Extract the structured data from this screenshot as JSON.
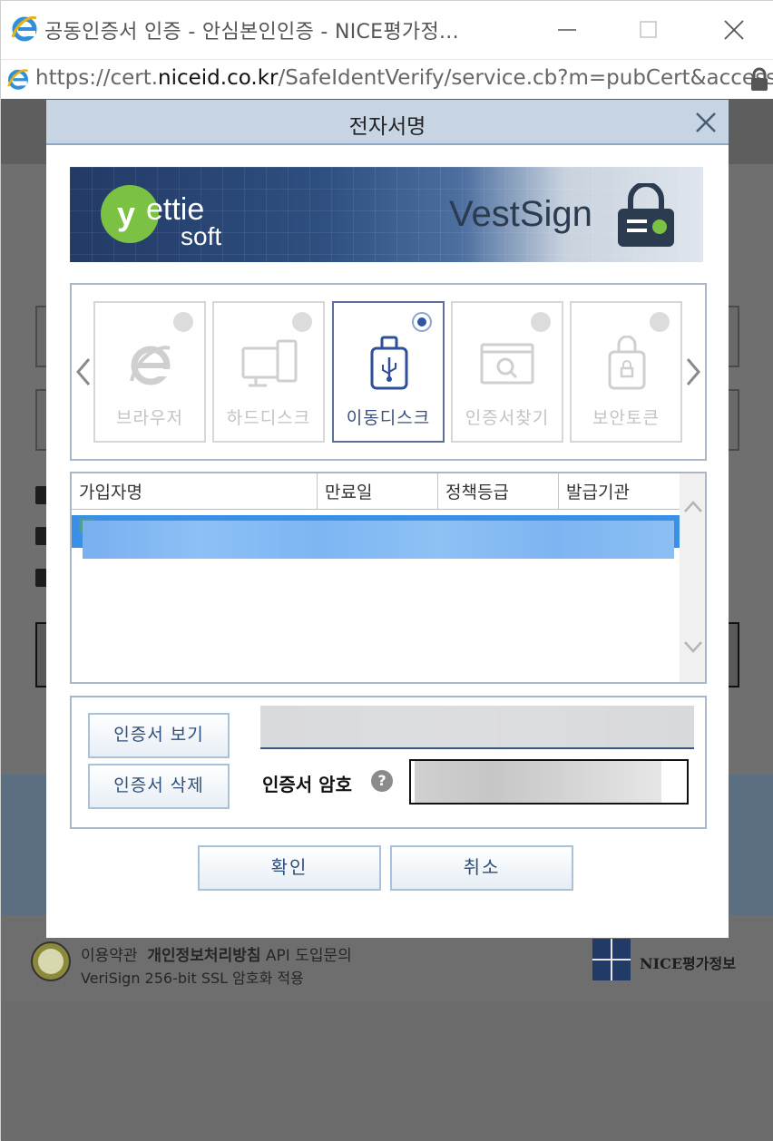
{
  "window": {
    "title": "공동인증서 인증 - 안심본인인증 - NICE평가정...",
    "url_prefix": "https://cert.",
    "url_host": "niceid.co.kr",
    "url_path": "/SafeIdentVerify/service.cb?m=pubCert&access_ni"
  },
  "dialog": {
    "title": "전자서명",
    "banner": {
      "left_logo_text": "yettie soft",
      "right_logo_text": "VestSign"
    },
    "storage_options": [
      {
        "label": "브라우저",
        "icon": "browser-icon",
        "selected": false
      },
      {
        "label": "하드디스크",
        "icon": "harddisk-icon",
        "selected": false
      },
      {
        "label": "이동디스크",
        "icon": "usb-drive-icon",
        "selected": true
      },
      {
        "label": "인증서찾기",
        "icon": "find-cert-icon",
        "selected": false
      },
      {
        "label": "보안토큰",
        "icon": "security-token-icon",
        "selected": false
      }
    ],
    "table": {
      "columns": [
        "가입자명",
        "만료일",
        "정책등급",
        "발급기관"
      ]
    },
    "buttons": {
      "view_cert": "인증서 보기",
      "delete_cert": "인증서 삭제",
      "ok": "확인",
      "cancel": "취소"
    },
    "password_label": "인증서 암호",
    "help_symbol": "?"
  },
  "background_page": {
    "footer_terms": "이용약관",
    "footer_privacy": "개인정보처리방침",
    "footer_api": "API 도입문의",
    "footer_ssl": "VeriSign 256-bit SSL 암호화 적용",
    "footer_brand": "NICE평가정보"
  },
  "colors": {
    "dialog_header_bg": "#c6d4e4",
    "selected_row": "#3a8fe6",
    "button_text": "#2d4e7a"
  }
}
